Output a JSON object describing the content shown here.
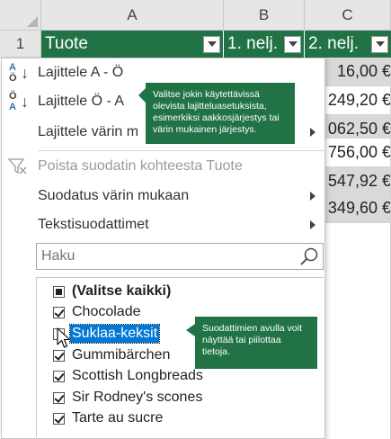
{
  "columns": [
    "A",
    "B",
    "C"
  ],
  "rows": [
    "1"
  ],
  "header_cells": [
    {
      "text": "Tuote"
    },
    {
      "text": "1. nelj."
    },
    {
      "text": "2. nelj."
    }
  ],
  "values_col_c": [
    "16,00 €",
    "249,20 €",
    "062,50 €",
    "756,00 €",
    "547,92 €",
    "349,60 €"
  ],
  "menu": {
    "sort_asc": "Lajittele A - Ö",
    "sort_desc": "Lajittele Ö - A",
    "sort_color": "Lajittele värin m",
    "clear_filter": "Poista suodatin kohteesta Tuote",
    "filter_color": "Suodatus värin mukaan",
    "text_filters": "Tekstisuodattimet"
  },
  "search": {
    "placeholder": "Haku"
  },
  "filter_list": [
    {
      "label": "(Valitse kaikki)",
      "state": "indeterminate"
    },
    {
      "label": "Chocolade",
      "state": "checked"
    },
    {
      "label": "Suklaa-keksit",
      "state": "unchecked"
    },
    {
      "label": "Gummibärchen",
      "state": "checked"
    },
    {
      "label": "Scottish Longbreads",
      "state": "checked"
    },
    {
      "label": "Sir Rodney's scones",
      "state": "checked"
    },
    {
      "label": "Tarte au sucre",
      "state": "checked"
    }
  ],
  "callouts": {
    "sort": "Valitse jokin käytettävissä olevista lajitteluasetuksista, esimerkiksi aakkosjärjestys tai värin mukainen järjestys.",
    "filter": "Suodattimien avulla voit näyttää tai piilottaa tietoja."
  },
  "colors": {
    "accent": "#217346",
    "selection": "#0078d7",
    "header_text": "#ffffff"
  },
  "icons": [
    "sort-ascending-icon",
    "sort-descending-icon",
    "clear-filter-icon",
    "search-icon",
    "dropdown-arrow-icon",
    "submenu-arrow-icon",
    "mouse-cursor-icon"
  ]
}
